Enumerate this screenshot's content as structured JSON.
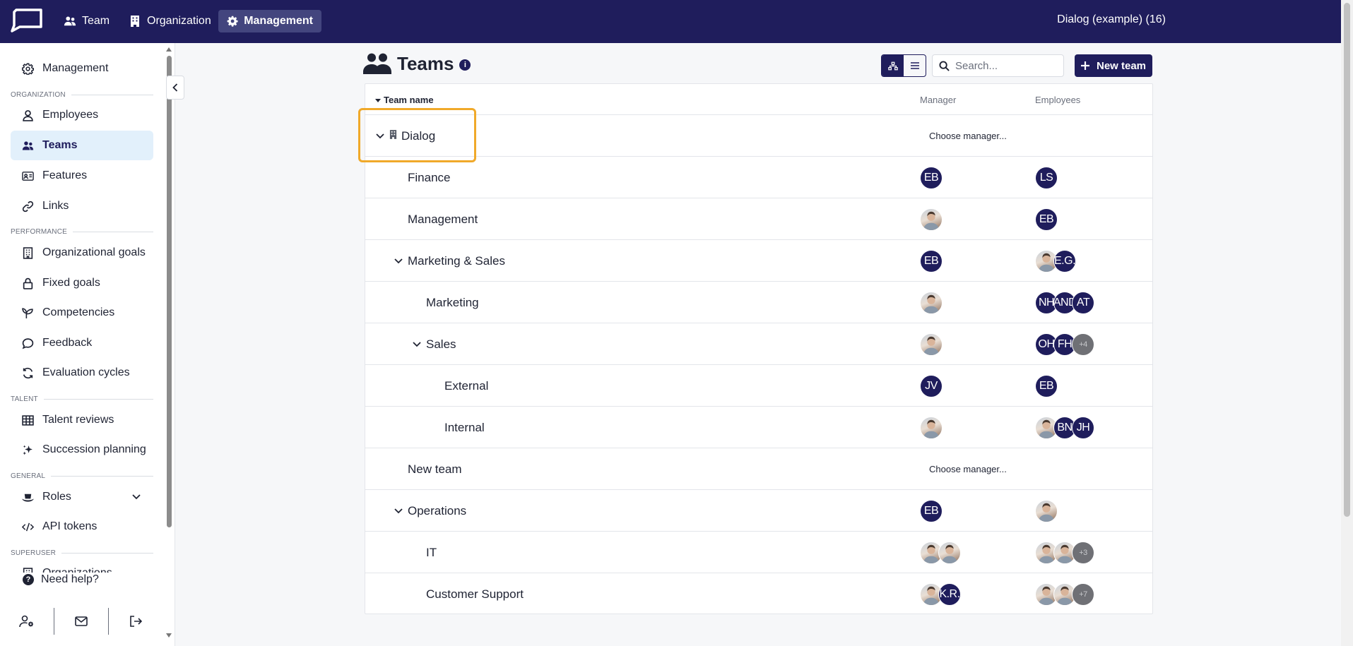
{
  "topbar": {
    "nav": [
      {
        "label": "Team",
        "icon": "users-icon"
      },
      {
        "label": "Organization",
        "icon": "building-icon"
      },
      {
        "label": "Management",
        "icon": "gear-icon",
        "active": true
      }
    ],
    "org_title": "Dialog (example) (16)"
  },
  "sidebar": {
    "top_item": {
      "label": "Management",
      "icon": "gear-icon"
    },
    "sections": {
      "organization": "ORGANIZATION",
      "performance": "PERFORMANCE",
      "talent": "TALENT",
      "general": "GENERAL",
      "superuser": "SUPERUSER"
    },
    "items": {
      "employees": "Employees",
      "teams": "Teams",
      "features": "Features",
      "links": "Links",
      "org_goals": "Organizational goals",
      "fixed_goals": "Fixed goals",
      "competencies": "Competencies",
      "feedback": "Feedback",
      "evaluation_cycles": "Evaluation cycles",
      "talent_reviews": "Talent reviews",
      "succession_planning": "Succession planning",
      "roles": "Roles",
      "api_tokens": "API tokens",
      "organizations": "Organizations"
    },
    "help": "Need help?"
  },
  "page": {
    "title": "Teams",
    "search_placeholder": "Search...",
    "new_team_label": "New team"
  },
  "table": {
    "headers": {
      "name": "Team name",
      "manager": "Manager",
      "employees": "Employees"
    },
    "choose_manager": "Choose manager...",
    "rows": [
      {
        "name": "Dialog",
        "level": 0,
        "expanded": true,
        "org_icon": true,
        "manager": "choose",
        "employees": []
      },
      {
        "name": "Finance",
        "level": 1,
        "manager": [
          "EB"
        ],
        "employees": [
          "LS"
        ]
      },
      {
        "name": "Management",
        "level": 1,
        "manager": [
          "photo"
        ],
        "employees": [
          "EB"
        ]
      },
      {
        "name": "Marketing & Sales",
        "level": 1,
        "expanded": true,
        "manager": [
          "EB"
        ],
        "employees": [
          "photo",
          "E.G."
        ]
      },
      {
        "name": "Marketing",
        "level": 2,
        "manager": [
          "photo"
        ],
        "employees": [
          "NH",
          "AND",
          "AT"
        ]
      },
      {
        "name": "Sales",
        "level": 2,
        "expanded": true,
        "manager": [
          "photo"
        ],
        "employees": [
          "OH",
          "FH",
          "+4"
        ]
      },
      {
        "name": "External",
        "level": 3,
        "manager": [
          "JV"
        ],
        "employees": [
          "EB"
        ]
      },
      {
        "name": "Internal",
        "level": 3,
        "manager": [
          "photo"
        ],
        "employees": [
          "photo",
          "BN",
          "JH"
        ]
      },
      {
        "name": "New team",
        "level": 1,
        "manager": "choose",
        "employees": []
      },
      {
        "name": "Operations",
        "level": 1,
        "expanded": true,
        "manager": [
          "EB"
        ],
        "employees": [
          "photo"
        ]
      },
      {
        "name": "IT",
        "level": 2,
        "manager": [
          "photo",
          "photo"
        ],
        "employees": [
          "photo",
          "photo",
          "+3"
        ]
      },
      {
        "name": "Customer Support",
        "level": 2,
        "manager": [
          "photo",
          "K.R."
        ],
        "employees": [
          "photo",
          "photo",
          "+7"
        ]
      }
    ]
  },
  "colors": {
    "brand": "#1f1d5c",
    "highlight": "#f0a92a",
    "active_bg": "#e2f0fb"
  }
}
